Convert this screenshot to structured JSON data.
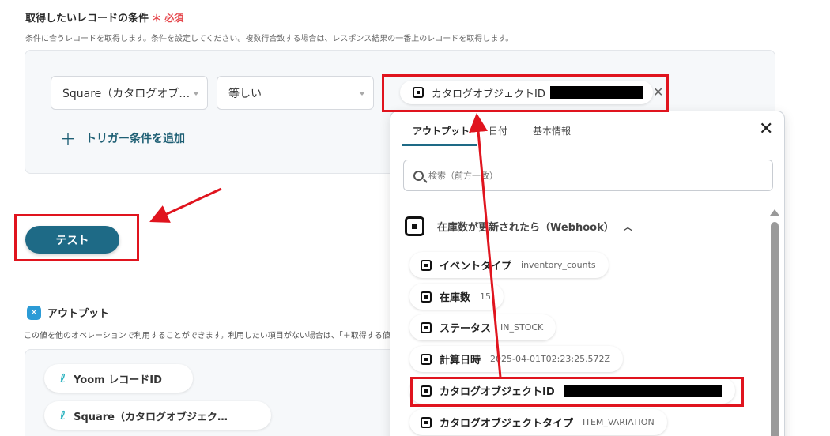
{
  "section": {
    "title": "取得したいレコードの条件",
    "required_mark": "＊",
    "required_label": "必須",
    "description": "条件に合うレコードを取得します。条件を設定してください。複数行合致する場合は、レスポンス結果の一番上のレコードを取得します。"
  },
  "condition": {
    "field_select": "Square（カタログオブ…",
    "operator_select": "等しい",
    "value_chip_label": "カタログオブジェクトID",
    "add_trigger_label": "トリガー条件を追加"
  },
  "test_button_label": "テスト",
  "output": {
    "title": "アウトプット",
    "description": "この値を他のオペレーションで利用することができます。利用したい項目がない場合は、「＋取得する値を追加」から追加してください。",
    "chips": [
      "Yoom レコードID",
      "Square（カタログオブジェク…"
    ]
  },
  "popup": {
    "tabs": [
      "アウトプット",
      "日付",
      "基本情報"
    ],
    "active_tab": "アウトプット",
    "search_placeholder": "検索（前方一致）",
    "group_title": "在庫数が更新されたら（Webhook）",
    "items": [
      {
        "label": "イベントタイプ",
        "value": "inventory_counts"
      },
      {
        "label": "在庫数",
        "value": "15"
      },
      {
        "label": "ステータス",
        "value": "IN_STOCK"
      },
      {
        "label": "計算日時",
        "value": "2025-04-01T02:23:25.572Z"
      },
      {
        "label": "カタログオブジェクトID",
        "value": ""
      },
      {
        "label": "カタログオブジェクトタイプ",
        "value": "ITEM_VARIATION"
      }
    ]
  },
  "colors": {
    "accent": "#1e6a86",
    "highlight_red": "#e0141e",
    "required_red": "#e5484d"
  }
}
